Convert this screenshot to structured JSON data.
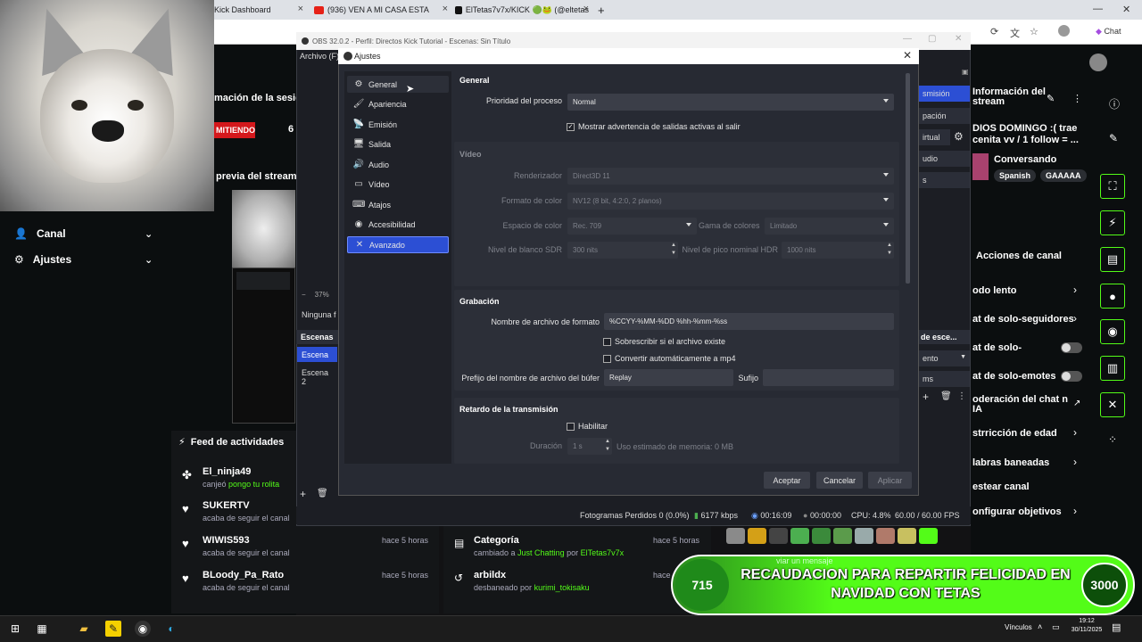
{
  "browser": {
    "tabs": [
      {
        "label": "Kick Dashboard"
      },
      {
        "label": "(936) VEN A MI CASA ESTA"
      },
      {
        "label": "ElTetas7v7x/KICK 🟢🐸 (@eltetas"
      }
    ],
    "new_tab": "+",
    "right_icons": [
      "Chat"
    ]
  },
  "kick_left": {
    "panel_title_1": "mación de la sesió",
    "live_badge": "MITIENDO",
    "live_number": "6",
    "panel_title_2": "previa del stream",
    "menu": [
      {
        "label": "Canal"
      },
      {
        "label": "Ajustes"
      }
    ]
  },
  "activity_feed": {
    "title": "Feed de actividades",
    "items": [
      {
        "user": "El_ninja49",
        "action": "canjeó",
        "highlight": "pongo tu rolita",
        "time": ""
      },
      {
        "user": "SUKERTV",
        "action": "acaba de seguir el canal",
        "highlight": "",
        "time": ""
      },
      {
        "user": "WIWIS593",
        "action": "acaba de seguir el canal",
        "highlight": "",
        "time": "hace 5 horas"
      },
      {
        "user": "BLoody_Pa_Rato",
        "action": "acaba de seguir el canal",
        "highlight": "",
        "time": "hace 5 horas"
      }
    ],
    "items2": [
      {
        "user": "Categoría",
        "action": "cambiado a",
        "highlight": "Just Chatting",
        "by": "por",
        "by_user": "ElTetas7v7x",
        "time": "hace 5 horas"
      },
      {
        "user": "arbildx",
        "action": "desbaneado por",
        "highlight": "kurimi_tokisaku",
        "time": "hace"
      }
    ]
  },
  "kick_right": {
    "info_title": "Información del stream",
    "stream_title": "DIOS DOMINGO :( trae cenita vv / 1 follow = ...",
    "category": "Conversando",
    "tags": [
      "Spanish",
      "GAAAAA"
    ],
    "actions_title": "Acciones de canal",
    "actions": [
      {
        "label": "odo lento"
      },
      {
        "label": "at de solo-seguidores"
      },
      {
        "label": "at de solo-"
      },
      {
        "label": "at de solo-emotes"
      },
      {
        "label": "oderación del chat n IA"
      },
      {
        "label": "strricción de edad"
      },
      {
        "label": "labras baneadas"
      },
      {
        "label": "estear canal"
      },
      {
        "label": "onfigurar objetivos"
      }
    ]
  },
  "obs": {
    "title": "OBS 32.0.2 - Perfil: Directos Kick Tutorial - Escenas: Sin Título",
    "menu_first": "Archivo (F)",
    "zoom": "37%",
    "no_source": "Ninguna f",
    "scenes_title": "Escenas",
    "scenes": [
      "Escena",
      "Escena 2"
    ],
    "dock_labels": [
      "smisión",
      "pación",
      "irtual",
      "udio",
      "s"
    ],
    "mixer_label": "de esce...",
    "dock_field": "ento",
    "dock_ms": "ms",
    "status": {
      "dropped": "Fotogramas Perdidos 0 (0.0%)",
      "kbps": "6177 kbps",
      "stream_time": "00:16:09",
      "rec_time": "00:00:00",
      "cpu": "CPU: 4.8%",
      "fps": "60.00 / 60.00 FPS"
    }
  },
  "settings": {
    "title": "Ajustes",
    "nav": [
      {
        "label": "General",
        "icon": "gear-icon",
        "glyph": "⚙"
      },
      {
        "label": "Apariencia",
        "icon": "brush-icon",
        "glyph": "🖌"
      },
      {
        "label": "Emisión",
        "icon": "antenna-icon",
        "glyph": "📡"
      },
      {
        "label": "Salida",
        "icon": "output-icon",
        "glyph": "🖥"
      },
      {
        "label": "Audio",
        "icon": "speaker-icon",
        "glyph": "🔊"
      },
      {
        "label": "Vídeo",
        "icon": "monitor-icon",
        "glyph": "▭"
      },
      {
        "label": "Atajos",
        "icon": "keyboard-icon",
        "glyph": "⌨"
      },
      {
        "label": "Accesibilidad",
        "icon": "accessibility-icon",
        "glyph": "◉"
      },
      {
        "label": "Avanzado",
        "icon": "wrench-icon",
        "glyph": "✕"
      }
    ],
    "active_nav": "Avanzado",
    "general": {
      "title": "General",
      "priority_label": "Prioridad del proceso",
      "priority_value": "Normal",
      "warn_label": "Mostrar advertencia de salidas activas al salir",
      "warn_checked": true
    },
    "video": {
      "title": "Vídeo",
      "renderer_label": "Renderizador",
      "renderer_value": "Direct3D 11",
      "color_format_label": "Formato de color",
      "color_format_value": "NV12 (8 bit, 4:2:0, 2 planos)",
      "color_space_label": "Espacio de color",
      "color_space_value": "Rec. 709",
      "gamut_label": "Gama de colores",
      "gamut_value": "Limitado",
      "sdr_label": "Nivel de blanco SDR",
      "sdr_value": "300 nits",
      "hdr_label": "Nivel de pico nominal HDR",
      "hdr_value": "1000 nits"
    },
    "recording": {
      "title": "Grabación",
      "filename_label": "Nombre de archivo de formato",
      "filename_value": "%CCYY-%MM-%DD %hh-%mm-%ss",
      "overwrite_label": "Sobrescribir si el archivo existe",
      "remux_label": "Convertir automáticamente a mp4",
      "prefix_label": "Prefijo del nombre de archivo del búfer",
      "prefix_value": "Replay",
      "suffix_label": "Sufijo",
      "suffix_value": ""
    },
    "delay": {
      "title": "Retardo de la transmisión",
      "enable_label": "Habilitar",
      "duration_label": "Duración",
      "duration_value": "1 s",
      "memory_label": "Uso estimado de memoria: 0 MB"
    },
    "buttons": {
      "accept": "Aceptar",
      "cancel": "Cancelar",
      "apply": "Aplicar"
    }
  },
  "banner": {
    "left_value": "715",
    "text": "RECAUDACION PARA REPARTIR FELICIDAD EN NAVIDAD CON TETAS",
    "right_value": "3000",
    "chat_placeholder": "viar un mensaje"
  },
  "taskbar": {
    "tray_label": "Vínculos",
    "time": "19:12",
    "date": "30/11/2025"
  },
  "colors": {
    "kick_green": "#53fc18",
    "obs_accent": "#2c4fd4",
    "live_red": "#d4181c"
  }
}
